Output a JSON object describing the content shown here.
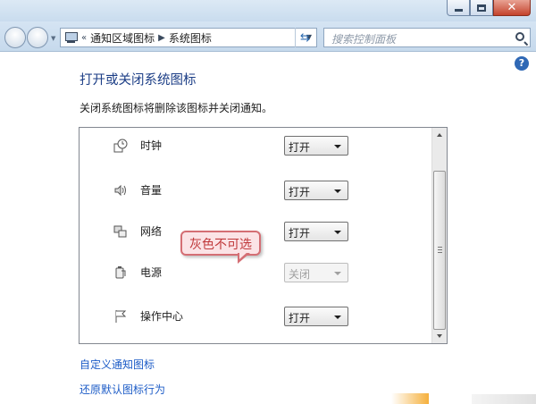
{
  "window": {
    "controls": {
      "minimize_icon": "minimize-icon",
      "maximize_icon": "maximize-icon",
      "close_glyph": "✕"
    }
  },
  "nav": {
    "breadcrumb": [
      "通知区域图标",
      "系统图标"
    ],
    "overflow": "«",
    "search_placeholder": "搜索控制面板"
  },
  "content": {
    "title": "打开或关闭系统图标",
    "description": "关闭系统图标将删除该图标并关闭通知。",
    "help_glyph": "?",
    "rows": [
      {
        "label": "时钟",
        "icon": "clock-icon",
        "value": "打开",
        "disabled": false
      },
      {
        "label": "音量",
        "icon": "speaker-icon",
        "value": "打开",
        "disabled": false
      },
      {
        "label": "网络",
        "icon": "network-icon",
        "value": "打开",
        "disabled": false
      },
      {
        "label": "电源",
        "icon": "battery-icon",
        "value": "关闭",
        "disabled": true
      },
      {
        "label": "操作中心",
        "icon": "flag-icon",
        "value": "打开",
        "disabled": false
      }
    ],
    "annotation": "灰色不可选",
    "links": [
      "自定义通知图标",
      "还原默认图标行为"
    ]
  },
  "colors": {
    "title": "#1c3e86",
    "link": "#1d5cc7",
    "annotation_border": "#d46e74",
    "annotation_text": "#c0393b"
  }
}
